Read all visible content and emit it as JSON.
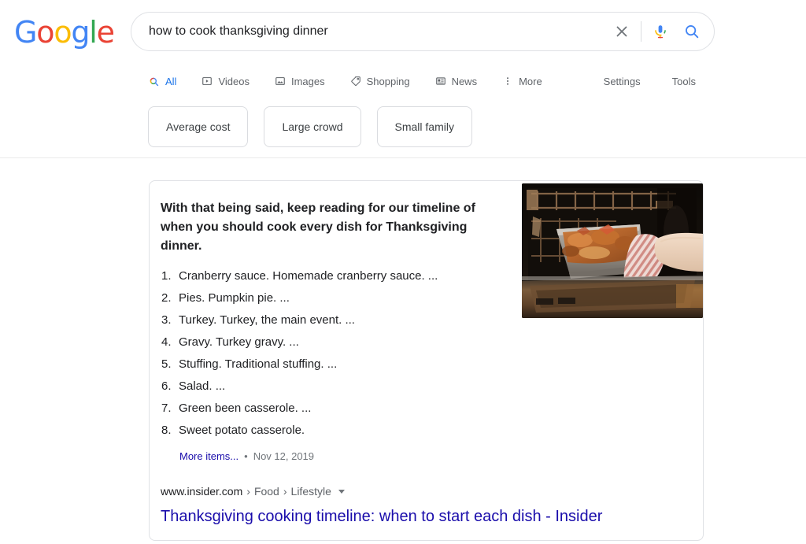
{
  "brand": {
    "logo_text": "Google",
    "logo_letters": [
      {
        "char": "G",
        "color": "#4285f4"
      },
      {
        "char": "o",
        "color": "#ea4335"
      },
      {
        "char": "o",
        "color": "#fbbc05"
      },
      {
        "char": "g",
        "color": "#4285f4"
      },
      {
        "char": "l",
        "color": "#34a853"
      },
      {
        "char": "e",
        "color": "#ea4335"
      }
    ]
  },
  "search": {
    "query": "how to cook thanksgiving dinner",
    "placeholder": "Search",
    "clear_icon": "close-icon",
    "voice_icon": "microphone-icon",
    "search_icon": "search-icon"
  },
  "tabs": [
    {
      "label": "All",
      "icon": "search-icon",
      "active": true
    },
    {
      "label": "Videos",
      "icon": "video-icon",
      "active": false
    },
    {
      "label": "Images",
      "icon": "image-icon",
      "active": false
    },
    {
      "label": "Shopping",
      "icon": "tag-icon",
      "active": false
    },
    {
      "label": "News",
      "icon": "news-icon",
      "active": false
    },
    {
      "label": "More",
      "icon": "more-vertical-icon",
      "active": false
    }
  ],
  "header_right": [
    {
      "label": "Settings"
    },
    {
      "label": "Tools"
    }
  ],
  "chips": [
    {
      "label": "Average cost"
    },
    {
      "label": "Large crowd"
    },
    {
      "label": "Small family"
    }
  ],
  "featured_snippet": {
    "title": "With that being said, keep reading for our timeline of when you should cook every dish for Thanksgiving dinner.",
    "items": [
      {
        "num": "1.",
        "text": "Cranberry sauce. Homemade cranberry sauce. ..."
      },
      {
        "num": "2.",
        "text": "Pies. Pumpkin pie. ..."
      },
      {
        "num": "3.",
        "text": "Turkey. Turkey, the main event. ..."
      },
      {
        "num": "4.",
        "text": "Gravy. Turkey gravy. ..."
      },
      {
        "num": "5.",
        "text": "Stuffing. Traditional stuffing. ..."
      },
      {
        "num": "6.",
        "text": "Salad. ..."
      },
      {
        "num": "7.",
        "text": "Green been casserole. ..."
      },
      {
        "num": "8.",
        "text": "Sweet potato casserole."
      }
    ],
    "more_items_label": "More items...",
    "separator": "•",
    "date": "Nov 12, 2019",
    "thumbnail_alt": "hand pulling roasting pan of turkey from oven with striped oven mitt",
    "result": {
      "domain": "www.insider.com",
      "breadcrumbs": [
        "Food",
        "Lifestyle"
      ],
      "breadcrumb_separator": "›",
      "dropdown_icon": "chevron-down-icon",
      "title": "Thanksgiving cooking timeline: when to start each dish - Insider"
    }
  },
  "colors": {
    "link": "#1a0dab",
    "active_tab": "#1a73e8",
    "muted": "#70757a",
    "text": "#202124",
    "border": "#dfe1e5"
  }
}
